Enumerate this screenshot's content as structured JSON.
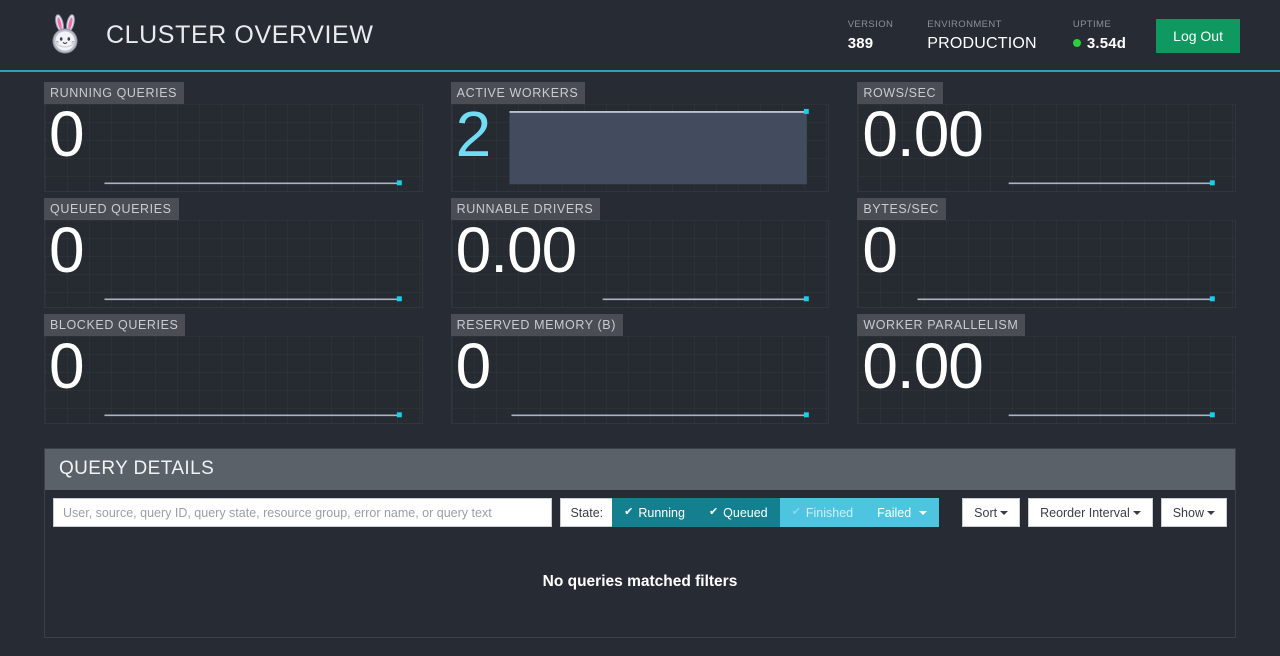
{
  "header": {
    "logo_icon": "rabbit-astronaut-logo",
    "title": "CLUSTER OVERVIEW",
    "version_label": "VERSION",
    "version_value": "389",
    "environment_label": "ENVIRONMENT",
    "environment_value": "PRODUCTION",
    "uptime_label": "UPTIME",
    "uptime_value": "3.54d",
    "uptime_status_color": "#2ecc40",
    "logout_label": "Log Out",
    "logout_color": "#0f9960",
    "accent_color": "#2aa3b8"
  },
  "cards": [
    {
      "label": "RUNNING QUERIES",
      "value": "0",
      "accent": false,
      "spark_style": "line",
      "spark_level": 0
    },
    {
      "label": "ACTIVE WORKERS",
      "value": "2",
      "accent": true,
      "spark_style": "area",
      "spark_level": 2
    },
    {
      "label": "ROWS/SEC",
      "value": "0.00",
      "accent": false,
      "spark_style": "line",
      "spark_level": 0
    },
    {
      "label": "QUEUED QUERIES",
      "value": "0",
      "accent": false,
      "spark_style": "line",
      "spark_level": 0
    },
    {
      "label": "RUNNABLE DRIVERS",
      "value": "0.00",
      "accent": false,
      "spark_style": "line",
      "spark_level": 0
    },
    {
      "label": "BYTES/SEC",
      "value": "0",
      "accent": false,
      "spark_style": "line",
      "spark_level": 0
    },
    {
      "label": "BLOCKED QUERIES",
      "value": "0",
      "accent": false,
      "spark_style": "line",
      "spark_level": 0
    },
    {
      "label": "RESERVED MEMORY (B)",
      "value": "0",
      "accent": false,
      "spark_style": "line",
      "spark_level": 0
    },
    {
      "label": "WORKER PARALLELISM",
      "value": "0.00",
      "accent": false,
      "spark_style": "line",
      "spark_level": 0
    }
  ],
  "query_details": {
    "title": "QUERY DETAILS",
    "search_placeholder": "User, source, query ID, query state, resource group, error name, or query text",
    "search_value": "",
    "state_label": "State:",
    "state_filters": [
      {
        "label": "Running",
        "checked": true,
        "style": "active-dark"
      },
      {
        "label": "Queued",
        "checked": true,
        "style": "active-dark"
      },
      {
        "label": "Finished",
        "checked": false,
        "style": "active-light"
      },
      {
        "label": "Failed",
        "checked": false,
        "style": "active-light",
        "dropdown": true
      }
    ],
    "sort_label": "Sort",
    "reorder_label": "Reorder Interval",
    "show_label": "Show",
    "empty_message": "No queries matched filters"
  }
}
